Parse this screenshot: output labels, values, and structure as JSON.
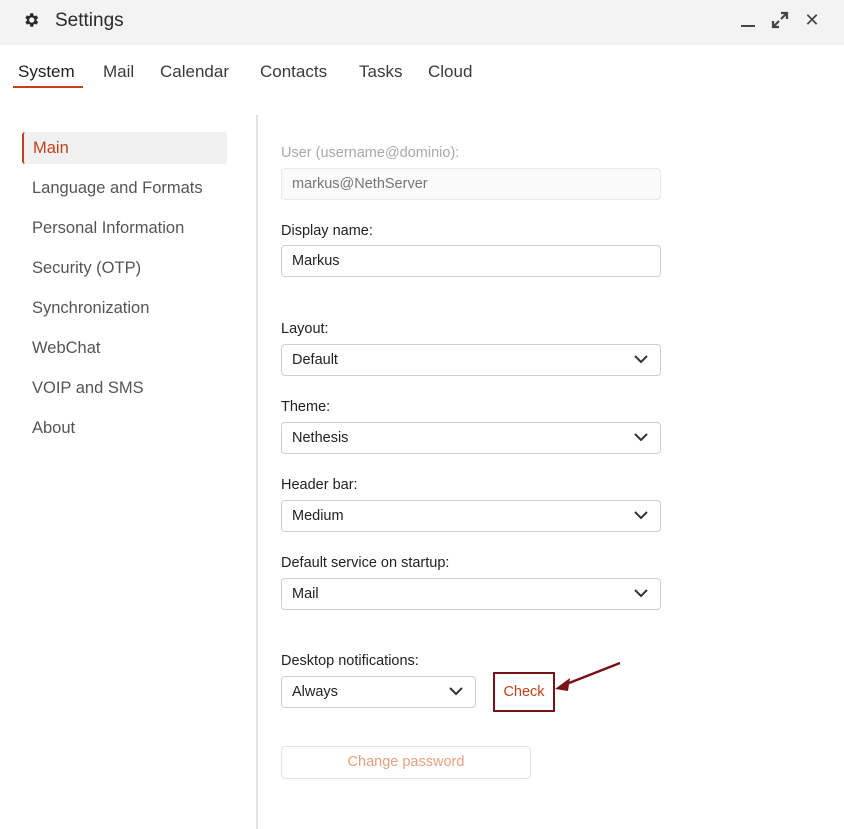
{
  "window": {
    "title": "Settings",
    "icons": {
      "title": "gear-icon",
      "minimize": "minimize-icon",
      "maximize": "expand-icon",
      "close": "close-icon"
    },
    "close_glyph": "✕"
  },
  "tabs": [
    {
      "label": "System",
      "active": true
    },
    {
      "label": "Mail"
    },
    {
      "label": "Calendar"
    },
    {
      "label": "Contacts"
    },
    {
      "label": "Tasks"
    },
    {
      "label": "Cloud"
    }
  ],
  "sidebar": {
    "items": [
      {
        "label": "Main",
        "active": true
      },
      {
        "label": "Language and Formats"
      },
      {
        "label": "Personal Information"
      },
      {
        "label": "Security (OTP)"
      },
      {
        "label": "Synchronization"
      },
      {
        "label": "WebChat"
      },
      {
        "label": "VOIP and SMS"
      },
      {
        "label": "About"
      }
    ]
  },
  "form": {
    "user": {
      "label": "User (username@dominio):",
      "placeholder": "markus@NethServer"
    },
    "display_name": {
      "label": "Display name:",
      "value": "Markus"
    },
    "layout": {
      "label": "Layout:",
      "value": "Default"
    },
    "theme": {
      "label": "Theme:",
      "value": "Nethesis"
    },
    "header_bar": {
      "label": "Header bar:",
      "value": "Medium"
    },
    "default_service": {
      "label": "Default service on startup:",
      "value": "Mail"
    },
    "notifications": {
      "label": "Desktop notifications:",
      "value": "Always",
      "check_label": "Check"
    },
    "change_password_label": "Change password"
  },
  "colors": {
    "accent": "#c43f1a",
    "highlight_box": "#7a1018",
    "muted_button_text": "#e8a07f"
  }
}
